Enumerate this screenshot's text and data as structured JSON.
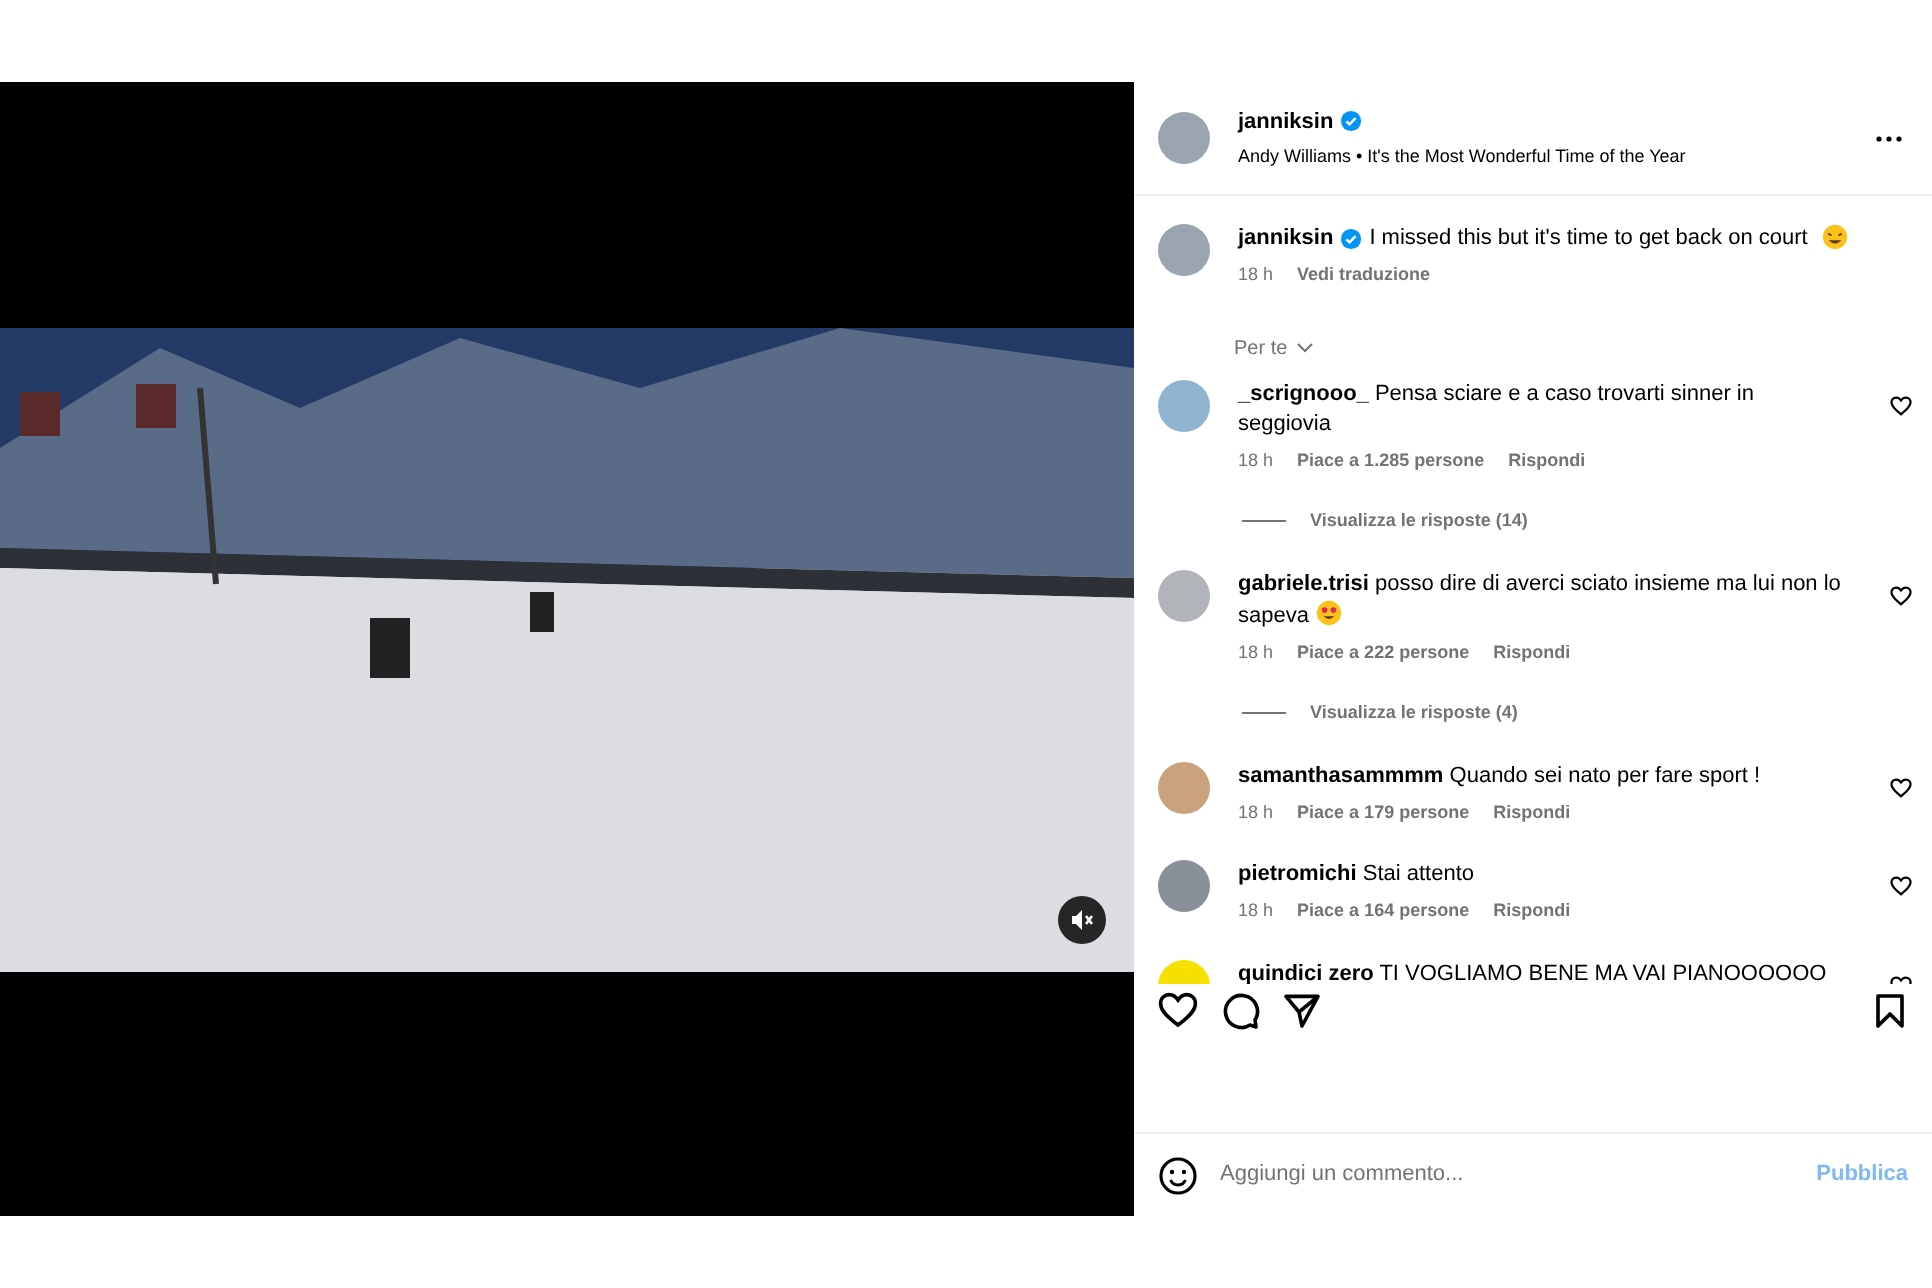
{
  "post": {
    "username": "janniksin",
    "audio": "Andy Williams • It's the Most Wonderful Time of the Year",
    "verified": true
  },
  "caption": {
    "username": "janniksin",
    "text": "I missed this but it's time to get back on court",
    "time": "18 h",
    "translate": "Vedi traduzione"
  },
  "sort": {
    "label": "Per te"
  },
  "comments": [
    {
      "username": "_scrignooo_",
      "text": "Pensa sciare e a caso trovarti sinner in seggiovia",
      "time": "18 h",
      "likes": "Piace a 1.285 persone",
      "reply": "Rispondi",
      "replies": "Visualizza le risposte (14)"
    },
    {
      "username": "gabriele.trisi",
      "text": "posso dire di averci sciato insieme ma lui non lo sapeva",
      "emoji": true,
      "time": "18 h",
      "likes": "Piace a 222 persone",
      "reply": "Rispondi",
      "replies": "Visualizza le risposte (4)"
    },
    {
      "username": "samanthasammmm",
      "text": "Quando sei nato per fare sport !",
      "time": "18 h",
      "likes": "Piace a 179 persone",
      "reply": "Rispondi"
    },
    {
      "username": "pietromichi",
      "text": "Stai attento",
      "time": "18 h",
      "likes": "Piace a 164 persone",
      "reply": "Rispondi"
    },
    {
      "username": "quindici zero",
      "text": "TI VOGLIAMO BENE MA VAI PIANOOOOOO"
    }
  ],
  "composer": {
    "placeholder": "Aggiungi un commento...",
    "submit": "Pubblica"
  }
}
